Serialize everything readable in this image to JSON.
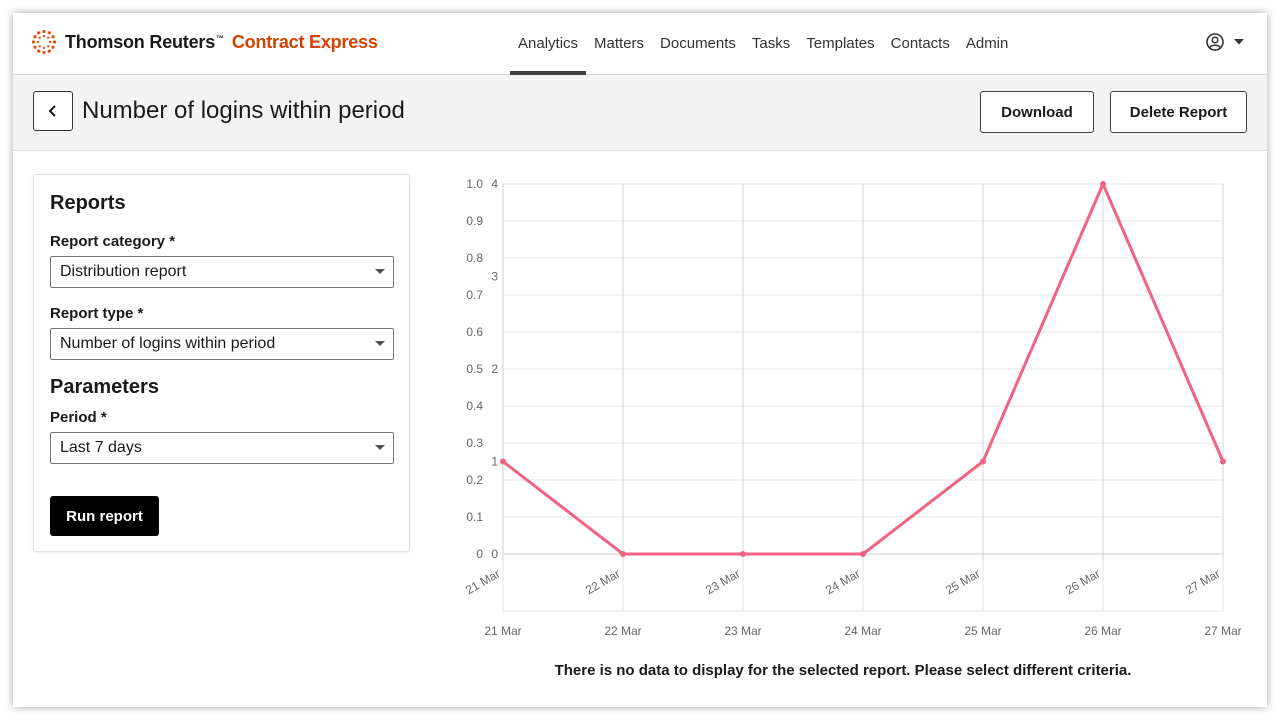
{
  "brand": {
    "company": "Thomson Reuters",
    "trademark": "™",
    "product": "Contract Express",
    "product_color": "#d64000"
  },
  "nav": {
    "items": [
      {
        "label": "Analytics",
        "active": true
      },
      {
        "label": "Matters",
        "active": false
      },
      {
        "label": "Documents",
        "active": false
      },
      {
        "label": "Tasks",
        "active": false
      },
      {
        "label": "Templates",
        "active": false
      },
      {
        "label": "Contacts",
        "active": false
      },
      {
        "label": "Admin",
        "active": false
      }
    ],
    "user_icon": "user-circle-icon"
  },
  "header": {
    "title": "Number of logins within period",
    "download_label": "Download",
    "delete_label": "Delete Report"
  },
  "panel": {
    "reports_heading": "Reports",
    "category_label": "Report category *",
    "category_value": "Distribution report",
    "type_label": "Report type *",
    "type_value": "Number of logins within period",
    "parameters_heading": "Parameters",
    "period_label": "Period *",
    "period_value": "Last 7 days",
    "run_label": "Run report"
  },
  "chart_data": {
    "type": "line",
    "title": "",
    "xlabel": "",
    "ylabel": "",
    "categories": [
      "21 Mar",
      "22 Mar",
      "23 Mar",
      "24 Mar",
      "25 Mar",
      "26 Mar",
      "27 Mar"
    ],
    "series": [
      {
        "values": [
          1,
          0,
          0,
          0,
          1,
          4,
          1
        ],
        "color": "#f06383"
      }
    ],
    "ylim": [
      0,
      4
    ],
    "y_ticks": [
      "0",
      "1",
      "2",
      "3",
      "4"
    ],
    "y2_ticks": [
      "0",
      "0.1",
      "0.2",
      "0.3",
      "0.4",
      "0.5",
      "0.6",
      "0.7",
      "0.8",
      "0.9",
      "1.0"
    ],
    "x_ticks_rotated": [
      "21 Mar",
      "22 Mar",
      "23 Mar",
      "24 Mar",
      "25 Mar",
      "26 Mar",
      "27 Mar"
    ],
    "grid": true
  },
  "empty_message": "There is no data to display for the selected report. Please select different criteria."
}
